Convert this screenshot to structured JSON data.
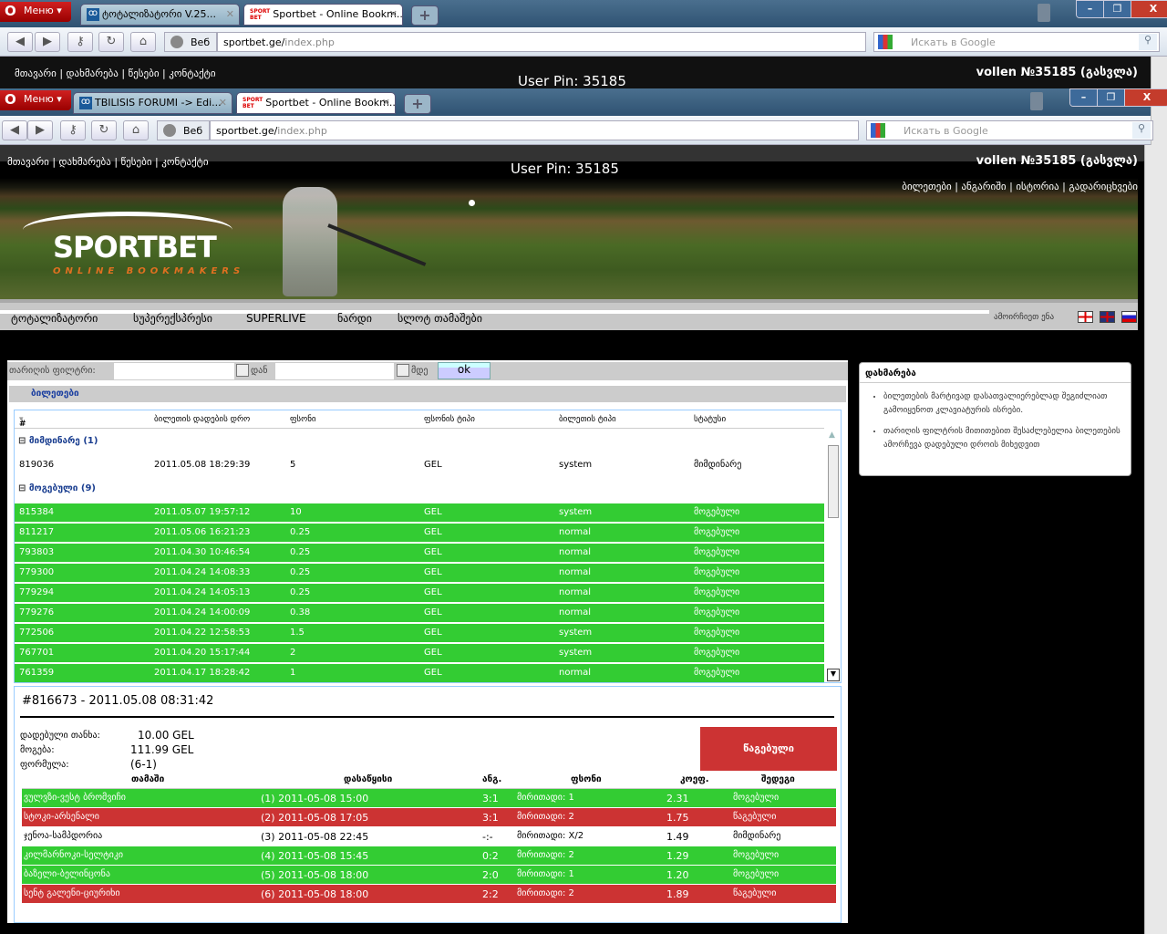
{
  "outer_browser": {
    "menu": "Меню",
    "tabs": [
      {
        "title": "ტოტალიზატორი V.25..."
      },
      {
        "title": "Sportbet - Online Bookm..."
      }
    ],
    "web_label": "Веб",
    "url_host": "sportbet.ge/",
    "url_path": "index.php",
    "search_placeholder": "Искать в Google"
  },
  "inner_browser": {
    "menu": "Меню",
    "tabs": [
      {
        "title": "TBILISIS FORUMI -> Edi..."
      },
      {
        "title": "Sportbet - Online Bookm..."
      }
    ],
    "web_label": "Веб",
    "url_host": "sportbet.ge/",
    "url_path": "index.php",
    "search_placeholder": "Искать в Google"
  },
  "header": {
    "links": [
      "მთავარი",
      "დახმარება",
      "წესები",
      "კონტაქტი"
    ],
    "user_pin": "User Pin: 35185",
    "user": "vollen №35185 (გასვლა)",
    "account_links": [
      "ბილეთები",
      "ანგარიში",
      "ისტორია",
      "გადარიცხვები"
    ]
  },
  "brand": {
    "logo": "SPORTBET",
    "tagline": "ONLINE BOOKMAKERS"
  },
  "nav": {
    "items": [
      "ტოტალიზატორი",
      "სუპერექსპრესი",
      "SUPERLIVE",
      "ნარდი",
      "სლოტ თამაშები"
    ],
    "language_label": "ამოირჩიეთ ენა"
  },
  "filter": {
    "label": "თარიღის ფილტრი:",
    "from": "დან",
    "to": "მდე",
    "ok": "ok"
  },
  "tickets": {
    "title": "ბილეთები",
    "columns": [
      "#",
      "ბილეთის დადების დრო",
      "ფსონი",
      "ფსონის ტიპი",
      "ბილეთის ტიპი",
      "სტატუსი"
    ],
    "groups": [
      {
        "label": "მიმდინარე (1)",
        "status": "pending",
        "rows": [
          [
            "819036",
            "2011.05.08 18:29:39",
            "5",
            "GEL",
            "system",
            "მიმდინარე"
          ]
        ]
      },
      {
        "label": "მოგებული (9)",
        "status": "won",
        "rows": [
          [
            "815384",
            "2011.05.07 19:57:12",
            "10",
            "GEL",
            "system",
            "მოგებული"
          ],
          [
            "811217",
            "2011.05.06 16:21:23",
            "0.25",
            "GEL",
            "normal",
            "მოგებული"
          ],
          [
            "793803",
            "2011.04.30 10:46:54",
            "0.25",
            "GEL",
            "normal",
            "მოგებული"
          ],
          [
            "779300",
            "2011.04.24 14:08:33",
            "0.25",
            "GEL",
            "normal",
            "მოგებული"
          ],
          [
            "779294",
            "2011.04.24 14:05:13",
            "0.25",
            "GEL",
            "normal",
            "მოგებული"
          ],
          [
            "779276",
            "2011.04.24 14:00:09",
            "0.38",
            "GEL",
            "normal",
            "მოგებული"
          ],
          [
            "772506",
            "2011.04.22 12:58:53",
            "1.5",
            "GEL",
            "system",
            "მოგებული"
          ],
          [
            "767701",
            "2011.04.20 15:17:44",
            "2",
            "GEL",
            "system",
            "მოგებული"
          ],
          [
            "761359",
            "2011.04.17 18:28:42",
            "1",
            "GEL",
            "normal",
            "მოგებული"
          ]
        ]
      }
    ]
  },
  "detail": {
    "title": "#816673 - 2011.05.08 08:31:42",
    "stake_label": "დადებული თანხა:",
    "stake": "10.00 GEL",
    "win_label": "მოგება:",
    "win": "111.99 GEL",
    "formula_label": "ფორმულა:",
    "formula": "(6-1)",
    "status": "წაგებული",
    "columns": [
      "თამაში",
      "დასაწყისი",
      "ანგ.",
      "ფსონი",
      "კოეფ.",
      "შედეგი"
    ],
    "matches": [
      {
        "game": "ვულვზი-ვესტ ბრომვიჩი",
        "start": "(1) 2011-05-08 15:00",
        "score": "3:1",
        "bet": "მირითადი: 1",
        "coef": "2.31",
        "result": "მოგებული",
        "state": "won"
      },
      {
        "game": "სტოკი-არსენალი",
        "start": "(2) 2011-05-08 17:05",
        "score": "3:1",
        "bet": "მირითადი: 2",
        "coef": "1.75",
        "result": "წაგებული",
        "state": "lost"
      },
      {
        "game": "ჯენოა-სამპდორია",
        "start": "(3) 2011-05-08 22:45",
        "score": "-:-",
        "bet": "მირითადი: X/2",
        "coef": "1.49",
        "result": "მიმდინარე",
        "state": "pend"
      },
      {
        "game": "კილმარნოკი-სელტიკი",
        "start": "(4) 2011-05-08 15:45",
        "score": "0:2",
        "bet": "მირითადი: 2",
        "coef": "1.29",
        "result": "მოგებული",
        "state": "won"
      },
      {
        "game": "ბაზელი-ბელინცონა",
        "start": "(5) 2011-05-08 18:00",
        "score": "2:0",
        "bet": "მირითადი: 1",
        "coef": "1.20",
        "result": "მოგებული",
        "state": "won"
      },
      {
        "game": "სენტ გალენი-ციურიხი",
        "start": "(6) 2011-05-08 18:00",
        "score": "2:2",
        "bet": "მირითადი: 2",
        "coef": "1.89",
        "result": "წაგებული",
        "state": "lost"
      }
    ]
  },
  "help": {
    "title": "დახმარება",
    "items": [
      "ბილეთების მარტივად დასათვალიერებლად შეგიძლიათ გამოიყენოთ კლავიატურის ისრები.",
      "თარიღის ფილტრის მითითებით შესაძლებელია ბილეთების ამორჩევა დადებული დროის მიხედვით"
    ]
  },
  "colors": {
    "won": "#33cc33",
    "lost": "#cc3333",
    "link": "#1a3ea0"
  }
}
